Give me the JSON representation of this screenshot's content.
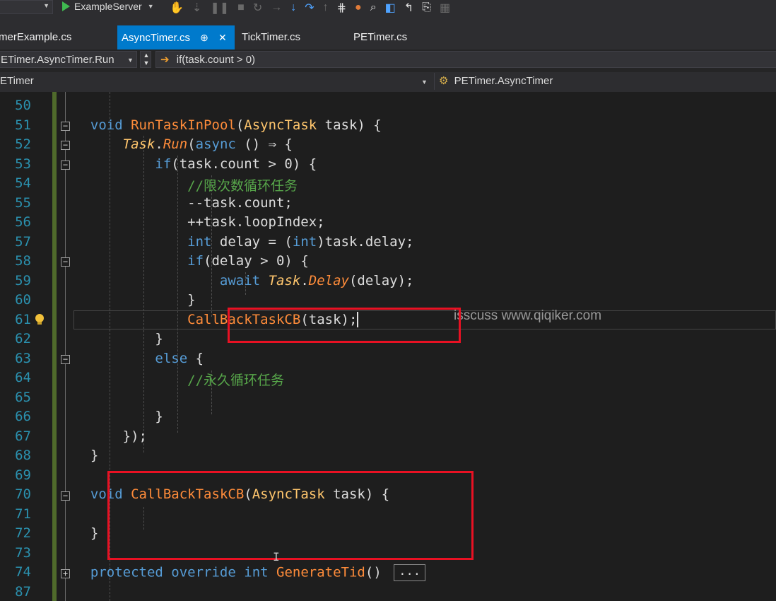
{
  "toolbar": {
    "start_target": "ExampleServer",
    "icons": [
      "hand-icon",
      "step-icon",
      "pause-icon",
      "stop-icon",
      "restart-icon",
      "step-over-icon",
      "step-into-icon",
      "step-out-icon",
      "step-back-icon",
      "breakpoint-icon",
      "find-icon",
      "bookmark-icon"
    ]
  },
  "tabs": [
    {
      "label": "merExample.cs",
      "active": false
    },
    {
      "label": "AsyncTimer.cs",
      "active": true,
      "pin": "⊕",
      "close": "✕"
    },
    {
      "label": "TickTimer.cs",
      "active": false
    },
    {
      "label": "PETimer.cs",
      "active": false
    }
  ],
  "nav": {
    "member": "ETimer.AsyncTimer.Run",
    "context": "if(task.count > 0)",
    "project": "ETimer",
    "class": "PETimer.AsyncTimer"
  },
  "lines": [
    {
      "num": "50",
      "html": ""
    },
    {
      "num": "51",
      "html": "        <span class=\"kw\">void</span> <span class=\"mt\">RunTaskInPool</span>(<span class=\"ty\">AsyncTask</span> task) {"
    },
    {
      "num": "52",
      "html": "            <span class=\"ty it\">Task</span>.<span class=\"mt it\">Run</span>(<span class=\"kw\">async</span> () ⇒ {"
    },
    {
      "num": "53",
      "html": "                <span class=\"kw\">if</span>(task.count &gt; 0) {"
    },
    {
      "num": "54",
      "html": "                    <span class=\"cm\">//限次数循环任务</span>"
    },
    {
      "num": "55",
      "html": "                    --task.count;"
    },
    {
      "num": "56",
      "html": "                    ++task.loopIndex;"
    },
    {
      "num": "57",
      "html": "                    <span class=\"kw\">int</span> delay = (<span class=\"kw\">int</span>)task.delay;"
    },
    {
      "num": "58",
      "html": "                    <span class=\"kw\">if</span>(delay &gt; 0) {"
    },
    {
      "num": "59",
      "html": "                        <span class=\"kw\">await</span> <span class=\"ty it\">Task</span>.<span class=\"mt it\">Delay</span>(delay);"
    },
    {
      "num": "60",
      "html": "                    }"
    },
    {
      "num": "61",
      "html": "                    <span class=\"mt\">CallBackTaskCB</span>(task);<span class=\"caret\"></span>"
    },
    {
      "num": "62",
      "html": "                }"
    },
    {
      "num": "63",
      "html": "                <span class=\"kw\">else</span> {"
    },
    {
      "num": "64",
      "html": "                    <span class=\"cm\">//永久循环任务</span>"
    },
    {
      "num": "65",
      "html": ""
    },
    {
      "num": "66",
      "html": "                }"
    },
    {
      "num": "67",
      "html": "            });"
    },
    {
      "num": "68",
      "html": "        }"
    },
    {
      "num": "69",
      "html": ""
    },
    {
      "num": "70",
      "html": "        <span class=\"kw\">void</span> <span class=\"mt\">CallBackTaskCB</span>(<span class=\"ty\">AsyncTask</span> task) {"
    },
    {
      "num": "71",
      "html": ""
    },
    {
      "num": "72",
      "html": "        }"
    },
    {
      "num": "73",
      "html": ""
    },
    {
      "num": "74",
      "html": "        <span class=\"kw\">protected</span> <span class=\"kw\">override</span> <span class=\"kw\">int</span> <span class=\"mt\">GenerateTid</span>() <span class=\"collapsed\">...</span>"
    },
    {
      "num": "87",
      "html": ""
    }
  ],
  "watermark": "isscuss www.qiqiker.com"
}
